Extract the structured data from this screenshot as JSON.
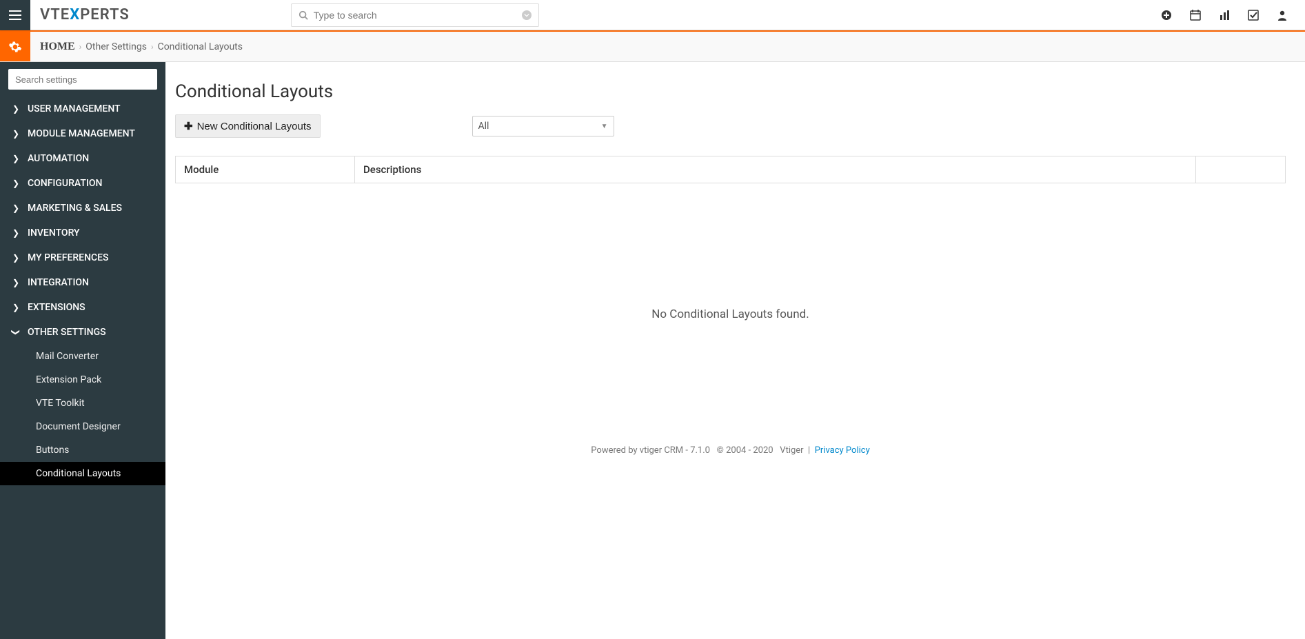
{
  "header": {
    "search_placeholder": "Type to search",
    "logo_plain1": "VTE",
    "logo_x": "X",
    "logo_plain2": "PERTS"
  },
  "breadcrumb": {
    "home": "HOME",
    "middle": "Other Settings",
    "last": "Conditional Layouts"
  },
  "sidebar": {
    "search_placeholder": "Search settings",
    "items": [
      {
        "label": "USER MANAGEMENT",
        "expanded": false
      },
      {
        "label": "MODULE MANAGEMENT",
        "expanded": false
      },
      {
        "label": "AUTOMATION",
        "expanded": false
      },
      {
        "label": "CONFIGURATION",
        "expanded": false
      },
      {
        "label": "MARKETING & SALES",
        "expanded": false
      },
      {
        "label": "INVENTORY",
        "expanded": false
      },
      {
        "label": "MY PREFERENCES",
        "expanded": false
      },
      {
        "label": "INTEGRATION",
        "expanded": false
      },
      {
        "label": "EXTENSIONS",
        "expanded": false
      },
      {
        "label": "OTHER SETTINGS",
        "expanded": true
      }
    ],
    "sub": [
      {
        "label": "Mail Converter",
        "active": false
      },
      {
        "label": "Extension Pack",
        "active": false
      },
      {
        "label": "VTE Toolkit",
        "active": false
      },
      {
        "label": "Document Designer",
        "active": false
      },
      {
        "label": "Buttons",
        "active": false
      },
      {
        "label": "Conditional Layouts",
        "active": true
      }
    ]
  },
  "main": {
    "title": "Conditional Layouts",
    "add_label": "New Conditional Layouts",
    "filter_selected": "All",
    "columns": {
      "module": "Module",
      "descriptions": "Descriptions"
    },
    "empty": "No Conditional Layouts found."
  },
  "footer": {
    "powered": "Powered by vtiger CRM - 7.1.0",
    "copyright": "© 2004 - 2020",
    "company": "Vtiger",
    "sep": "|",
    "privacy": "Privacy Policy"
  }
}
